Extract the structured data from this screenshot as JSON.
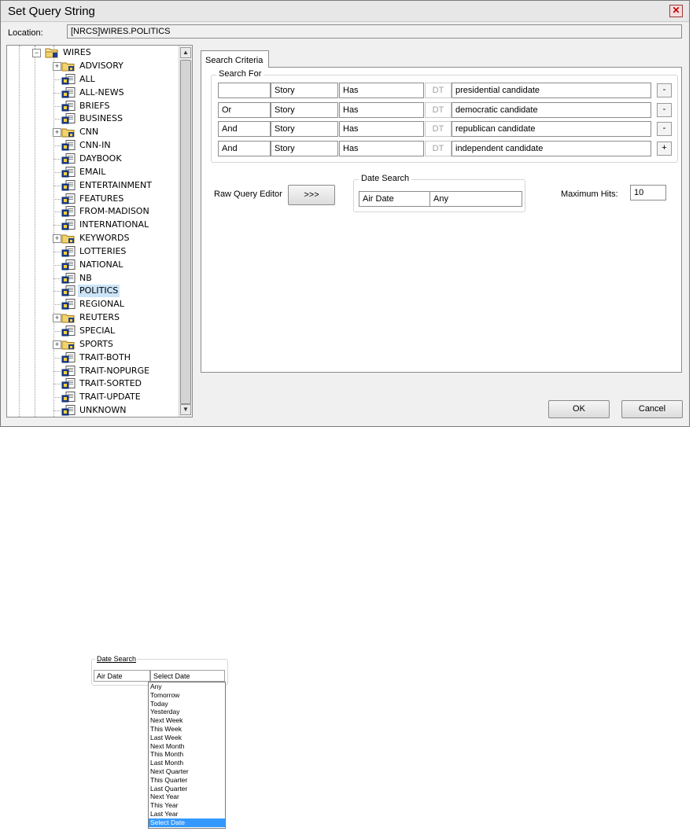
{
  "dialog": {
    "title": "Set Query String",
    "close_glyph": "✕",
    "location_label": "Location:",
    "location_value": "[NRCS]WIRES.POLITICS"
  },
  "tree": {
    "root": "WIRES",
    "items": [
      {
        "label": "ADVISORY",
        "folder": true,
        "expandable": true
      },
      {
        "label": "ALL",
        "folder": false
      },
      {
        "label": "ALL-NEWS",
        "folder": false
      },
      {
        "label": "BRIEFS",
        "folder": false
      },
      {
        "label": "BUSINESS",
        "folder": false
      },
      {
        "label": "CNN",
        "folder": true,
        "expandable": true
      },
      {
        "label": "CNN-IN",
        "folder": false
      },
      {
        "label": "DAYBOOK",
        "folder": false
      },
      {
        "label": "EMAIL",
        "folder": false
      },
      {
        "label": "ENTERTAINMENT",
        "folder": false
      },
      {
        "label": "FEATURES",
        "folder": false
      },
      {
        "label": "FROM-MADISON",
        "folder": false
      },
      {
        "label": "INTERNATIONAL",
        "folder": false
      },
      {
        "label": "KEYWORDS",
        "folder": true,
        "expandable": true
      },
      {
        "label": "LOTTERIES",
        "folder": false
      },
      {
        "label": "NATIONAL",
        "folder": false
      },
      {
        "label": "NB",
        "folder": false
      },
      {
        "label": "POLITICS",
        "folder": false,
        "selected": true
      },
      {
        "label": "REGIONAL",
        "folder": false
      },
      {
        "label": "REUTERS",
        "folder": true,
        "expandable": true
      },
      {
        "label": "SPECIAL",
        "folder": false
      },
      {
        "label": "SPORTS",
        "folder": true,
        "expandable": true
      },
      {
        "label": "TRAIT-BOTH",
        "folder": false
      },
      {
        "label": "TRAIT-NOPURGE",
        "folder": false
      },
      {
        "label": "TRAIT-SORTED",
        "folder": false
      },
      {
        "label": "TRAIT-UPDATE",
        "folder": false
      },
      {
        "label": "UNKNOWN",
        "folder": false
      }
    ]
  },
  "search": {
    "tab_label": "Search Criteria",
    "group_label": "Search For",
    "rows": [
      {
        "conj": "",
        "field": "Story",
        "op": "Has",
        "dt": "DT",
        "value": "presidential candidate",
        "btn": "-"
      },
      {
        "conj": "Or",
        "field": "Story",
        "op": "Has",
        "dt": "DT",
        "value": "democratic candidate",
        "btn": "-"
      },
      {
        "conj": "And",
        "field": "Story",
        "op": "Has",
        "dt": "DT",
        "value": "republican candidate",
        "btn": "-"
      },
      {
        "conj": "And",
        "field": "Story",
        "op": "Has",
        "dt": "DT",
        "value": "independent candidate",
        "btn": "+"
      }
    ],
    "raw_query_label": "Raw Query Editor",
    "raw_query_button": ">>>",
    "date_search_label": "Date Search",
    "date_field": "Air Date",
    "date_value": "Any",
    "max_hits_label": "Maximum Hits:",
    "max_hits_value": "10"
  },
  "buttons": {
    "ok": "OK",
    "cancel": "Cancel"
  },
  "date_dropdown": {
    "group_label": "Date Search",
    "field": "Air Date",
    "selected": "Select Date",
    "options": [
      "Any",
      "Tomorrow",
      "Today",
      "Yesterday",
      "Next Week",
      "This Week",
      "Last Week",
      "Next Month",
      "This Month",
      "Last Month",
      "Next Quarter",
      "This Quarter",
      "Last Quarter",
      "Next Year",
      "This Year",
      "Last Year",
      "Select Date"
    ],
    "highlighted_index": 16
  }
}
